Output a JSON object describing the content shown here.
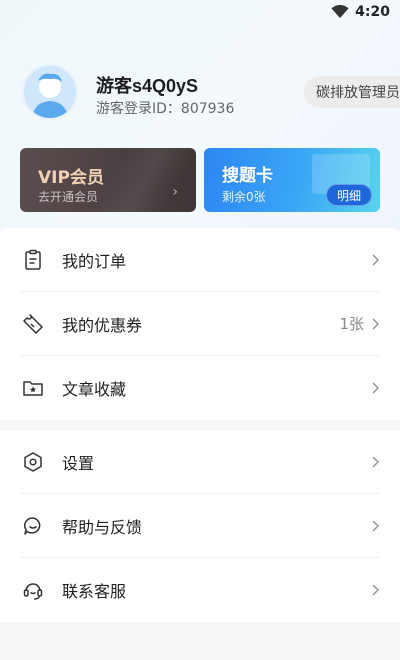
{
  "status_bar": {
    "time": "4:20"
  },
  "profile": {
    "name": "游客s4Q0yS",
    "login_id": "游客登录ID：807936",
    "admin_label": "碳排放管理员"
  },
  "vip_card": {
    "title": "VIP会员",
    "subtitle": "去开通会员",
    "chevron": "›"
  },
  "search_card": {
    "title": "搜题卡",
    "subtitle": "剩余0张",
    "detail_label": "明细"
  },
  "menu_group_1": [
    {
      "label": "我的订单",
      "value": "",
      "icon": "clipboard-icon"
    },
    {
      "label": "我的优惠券",
      "value": "1张",
      "icon": "ticket-icon"
    },
    {
      "label": "文章收藏",
      "value": "",
      "icon": "folder-star-icon"
    }
  ],
  "menu_group_2": [
    {
      "label": "设置",
      "value": "",
      "icon": "hexagon-settings-icon"
    },
    {
      "label": "帮助与反馈",
      "value": "",
      "icon": "chat-bubble-icon"
    },
    {
      "label": "联系客服",
      "value": "",
      "icon": "headset-icon"
    }
  ],
  "colors": {
    "vip_gold": "#f1d1b4",
    "search_blue": "#2d86f3",
    "detail_blue": "#1e67d9",
    "avatar_blue": "#cfe6fb"
  }
}
